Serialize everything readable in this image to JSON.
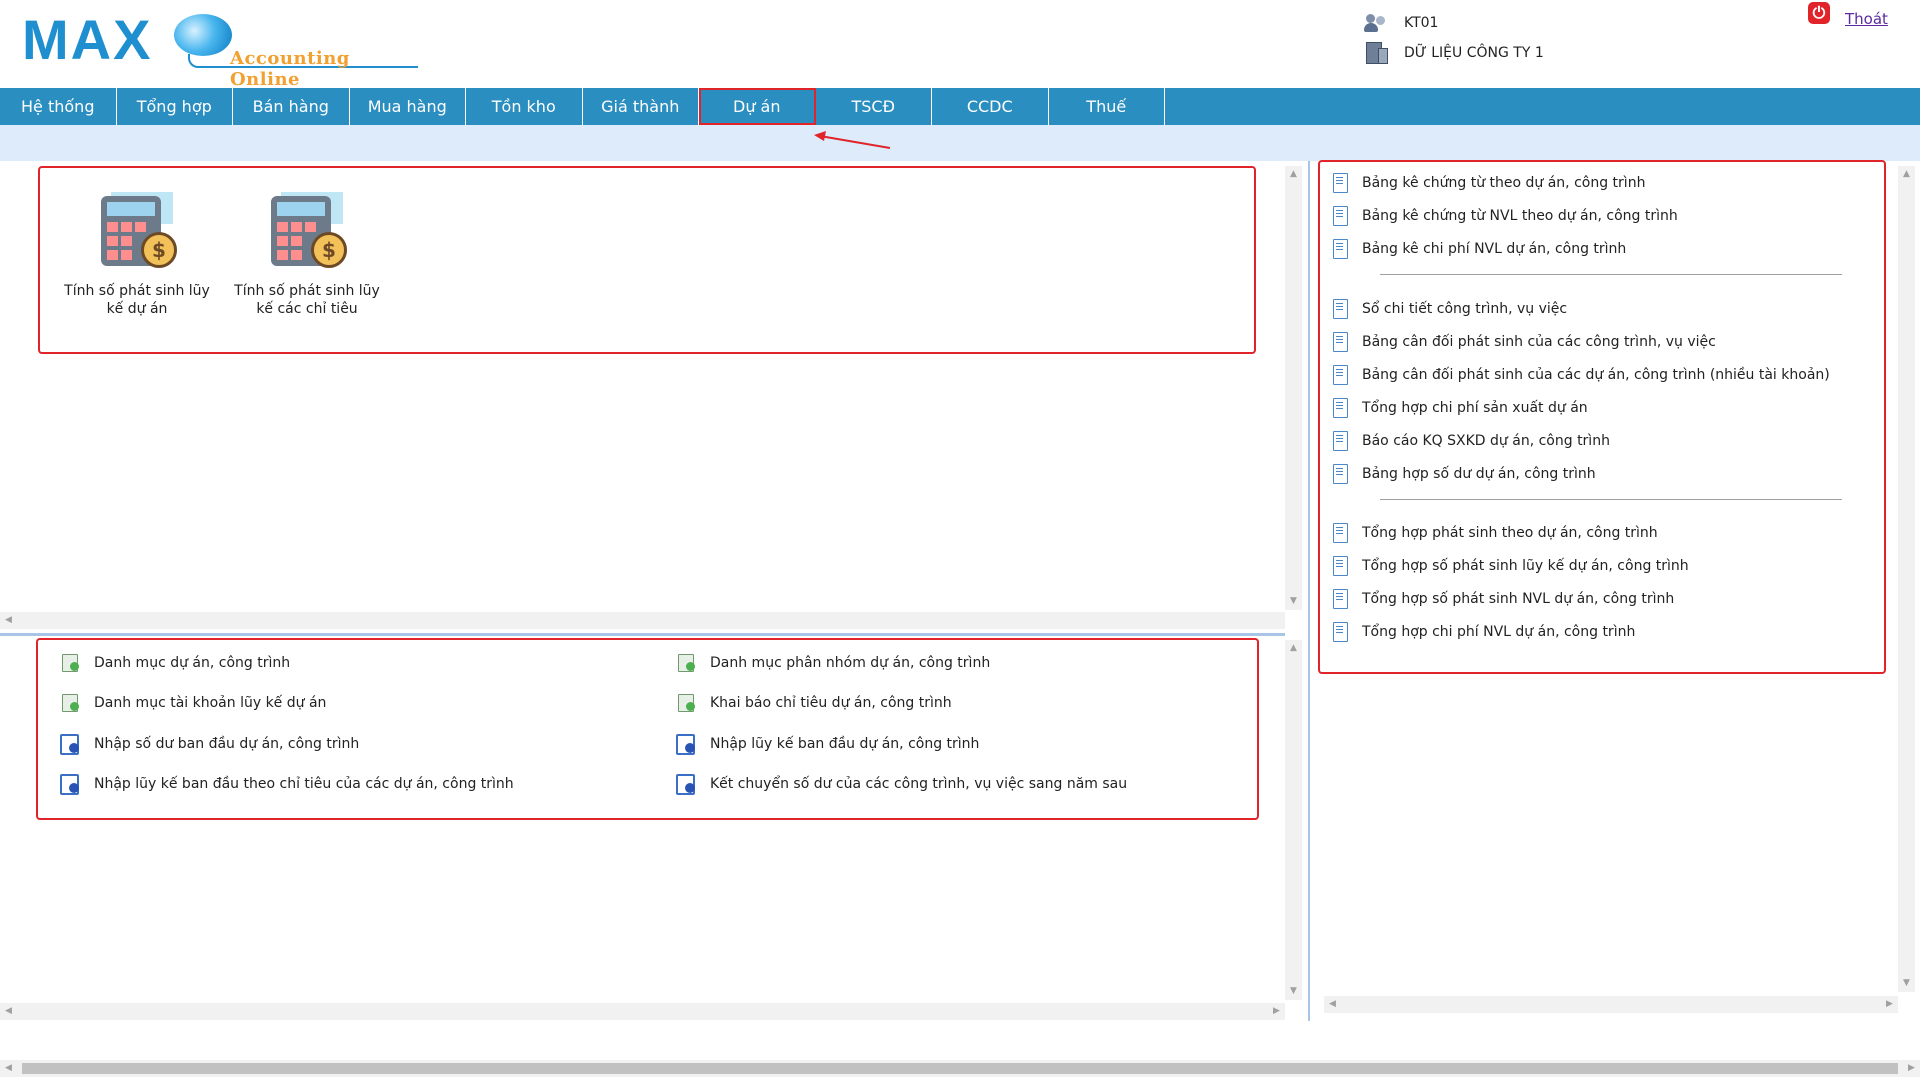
{
  "header": {
    "logo_main": "MAX",
    "logo_sub": "Accounting Online",
    "user_code": "KT01",
    "company": "DỮ LIỆU CÔNG TY 1",
    "logout": "Thoát"
  },
  "nav": {
    "items": [
      "Hệ thống",
      "Tổng hợp",
      "Bán hàng",
      "Mua hàng",
      "Tồn kho",
      "Giá thành",
      "Dự án",
      "TSCĐ",
      "CCDC",
      "Thuế"
    ],
    "active": "Dự án"
  },
  "tiles": [
    {
      "label": "Tính số phát sinh lũy kế dự án"
    },
    {
      "label": "Tính số phát sinh lũy kế các chỉ tiêu"
    }
  ],
  "catalog": {
    "left": [
      {
        "label": "Danh mục dự án, công trình",
        "icon": "list-icon"
      },
      {
        "label": "Danh mục tài khoản lũy kế dự án",
        "icon": "list-icon"
      },
      {
        "label": "Nhập số dư ban đầu dự án, công trình",
        "icon": "edit-icon"
      },
      {
        "label": "Nhập lũy kế ban đầu theo chỉ tiêu của các dự án, công trình",
        "icon": "edit-icon"
      }
    ],
    "right": [
      {
        "label": "Danh mục phân nhóm dự án, công trình",
        "icon": "list-icon"
      },
      {
        "label": "Khai báo chỉ tiêu dự án, công trình",
        "icon": "list-icon"
      },
      {
        "label": "Nhập lũy kế ban đầu dự án, công trình",
        "icon": "edit-icon"
      },
      {
        "label": "Kết chuyển số dư của các công trình, vụ việc sang năm sau",
        "icon": "edit-icon"
      }
    ]
  },
  "reports": {
    "group1": [
      "Bảng kê chứng từ theo dự án, công trình",
      "Bảng kê chứng từ NVL theo dự án, công trình",
      "Bảng kê chi phí NVL dự án, công trình"
    ],
    "group2": [
      "Sổ chi tiết công trình, vụ việc",
      "Bảng cân đối phát sinh của các công trình, vụ việc",
      "Bảng cân đối phát sinh của các dự án, công trình (nhiều tài khoản)",
      "Tổng hợp chi phí sản xuất dự án",
      "Báo cáo KQ SXKD dự án, công trình",
      "Bảng hợp số dư dự án, công trình"
    ],
    "group3": [
      "Tổng hợp phát sinh theo dự án, công trình",
      "Tổng hợp số phát sinh lũy kế dự án, công trình",
      "Tổng hợp số phát sinh NVL dự án, công trình",
      "Tổng hợp chi phí NVL dự án, công trình"
    ]
  },
  "colors": {
    "nav_bg": "#2a8ec0",
    "subbar_bg": "#ddebfa",
    "highlight": "#e0242a",
    "logo_blue": "#1f8fd0",
    "logo_orange": "#f2a030"
  }
}
